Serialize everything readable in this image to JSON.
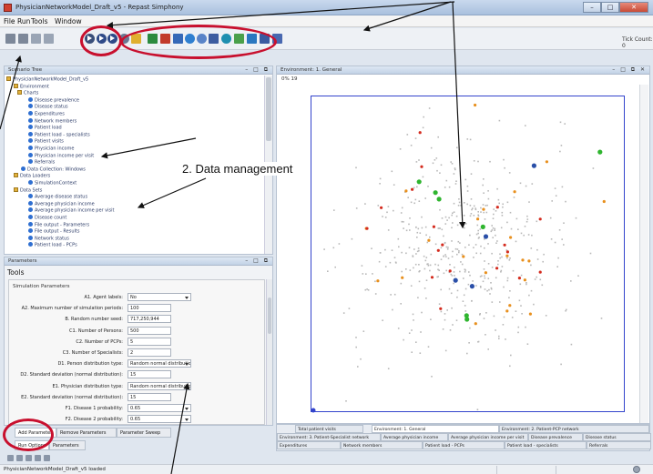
{
  "window": {
    "title": "PhysicianNetworkModel_Draft_v5 - Repast Simphony"
  },
  "menubar": {
    "items": [
      "File",
      "Run",
      "Tools",
      "Window"
    ]
  },
  "toolbar": {
    "tick_count_label": "Tick Count: 0",
    "colors": {
      "run_buttons": "#2e4a88",
      "accent": "#c8102e"
    }
  },
  "annotations": {
    "data_management_label": "2. Data management"
  },
  "scenario_tree": {
    "title": "Scenario Tree",
    "rows": [
      {
        "text": "PhysicianNetworkModel_Draft_v5",
        "icon": "folder"
      },
      {
        "text": "Environment",
        "icon": "folder"
      },
      {
        "text": "Charts",
        "icon": "folder"
      },
      {
        "text": "Disease prevalence",
        "icon": "chart"
      },
      {
        "text": "Disease status",
        "icon": "chart"
      },
      {
        "text": "Expenditures",
        "icon": "chart"
      },
      {
        "text": "Network members",
        "icon": "chart"
      },
      {
        "text": "Patient load",
        "icon": "chart"
      },
      {
        "text": "Patient load - specialists",
        "icon": "chart"
      },
      {
        "text": "Patient visits",
        "icon": "chart"
      },
      {
        "text": "Physician income",
        "icon": "chart"
      },
      {
        "text": "Physician income per visit",
        "icon": "chart"
      },
      {
        "text": "Referrals",
        "icon": "chart"
      },
      {
        "text": "Data Collection: Windows",
        "icon": "chart"
      },
      {
        "text": "Data Loaders",
        "icon": "folder"
      },
      {
        "text": "SimulationContext",
        "icon": "chart"
      },
      {
        "text": "Data Sets",
        "icon": "folder"
      },
      {
        "text": "Average disease status",
        "icon": "chart"
      },
      {
        "text": "Average physician income",
        "icon": "chart"
      },
      {
        "text": "Average physician income per visit",
        "icon": "chart"
      },
      {
        "text": "Disease count",
        "icon": "chart"
      },
      {
        "text": "File output - Parameters",
        "icon": "chart"
      },
      {
        "text": "File output - Results",
        "icon": "chart"
      },
      {
        "text": "Network status",
        "icon": "chart"
      },
      {
        "text": "Patient load - PCPs",
        "icon": "chart"
      }
    ]
  },
  "parameters": {
    "title": "Parameters",
    "tools_label": "Tools",
    "section_label": "Simulation Parameters",
    "rows": [
      {
        "label": "A1. Agent labels:",
        "value": "No",
        "kind": "select"
      },
      {
        "label": "A2. Maximum number of simulation periods:",
        "value": "100",
        "kind": "field"
      },
      {
        "label": "B. Random number seed:",
        "value": "717,250,944",
        "kind": "field"
      },
      {
        "label": "C1. Number of Persons:",
        "value": "500",
        "kind": "field"
      },
      {
        "label": "C2. Number of PCPs:",
        "value": "5",
        "kind": "field"
      },
      {
        "label": "C3. Number of Specialists:",
        "value": "2",
        "kind": "field"
      },
      {
        "label": "D1. Person distribution type:",
        "value": "Random normal distribution",
        "kind": "select"
      },
      {
        "label": "D2. Standard deviation (normal distribution):",
        "value": "15",
        "kind": "field"
      },
      {
        "label": "E1. Physician distribution type:",
        "value": "Random normal distribution",
        "kind": "select"
      },
      {
        "label": "E2. Standard deviation (normal distribution):",
        "value": "15",
        "kind": "field"
      },
      {
        "label": "F1. Disease 1 probability:",
        "value": "0.65",
        "kind": "select"
      },
      {
        "label": "F2. Disease 2 probability:",
        "value": "0.65",
        "kind": "select"
      }
    ],
    "tabs": [
      "Add Parameter",
      "Remove Parameters",
      "Parameter Sweep"
    ]
  },
  "run_tabs": [
    "Run Options",
    "Parameters"
  ],
  "display": {
    "title": "Environment: 1. General",
    "subbar_text": "0% 19",
    "plot": {
      "colors": {
        "person": "#b8b8b8",
        "pcp_orange": "#e8901e",
        "red": "#d42b1e",
        "green": "#2fb52f",
        "blue": "#2a4fa8",
        "frame": "#3344cc"
      }
    },
    "tabs_row1": [
      "Total patient visits",
      "Environment: 1. General",
      "Environment: 2. Patient-PCP network"
    ],
    "tabs_row2": [
      "Environment: 3. Patient-Specialist network",
      "Average physician income",
      "Average physician income per visit",
      "Disease prevalence",
      "Disease status"
    ],
    "tabs_row3": [
      "Expenditures",
      "Network members",
      "Patient load - PCPs",
      "Patient load - specialists",
      "Referrals"
    ]
  },
  "statusbar": {
    "message": "PhysicianNetworkModel_Draft_v5 loaded"
  }
}
